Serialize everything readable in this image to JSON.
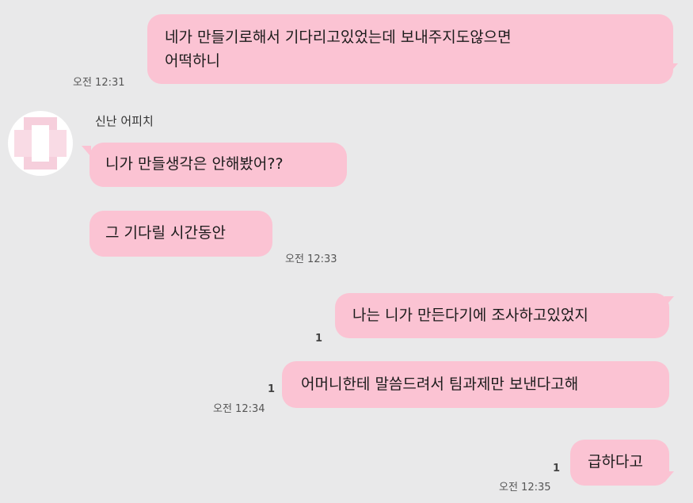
{
  "chat": {
    "partner_name": "신난 어피치",
    "colors": {
      "bubble": "#fbc3d3",
      "background": "#e9e9ea"
    },
    "messages": [
      {
        "from": "me",
        "lines": [
          "네가 만들기로해서 기다리고있었는데 보내주지도않으면",
          "어떡하니"
        ],
        "time": "오전 12:31"
      },
      {
        "from": "other",
        "text": "니가 만들생각은 안해봤어??"
      },
      {
        "from": "other",
        "text": "그 기다릴 시간동안",
        "time": "오전 12:33"
      },
      {
        "from": "me",
        "text": "나는 니가 만든다기에 조사하고있었지",
        "unread": "1"
      },
      {
        "from": "me",
        "text": "어머니한테 말씀드려서 팀과제만 보낸다고해",
        "unread": "1",
        "time": "오전 12:34"
      },
      {
        "from": "me",
        "text": "급하다고",
        "unread": "1",
        "time": "오전 12:35"
      }
    ]
  }
}
